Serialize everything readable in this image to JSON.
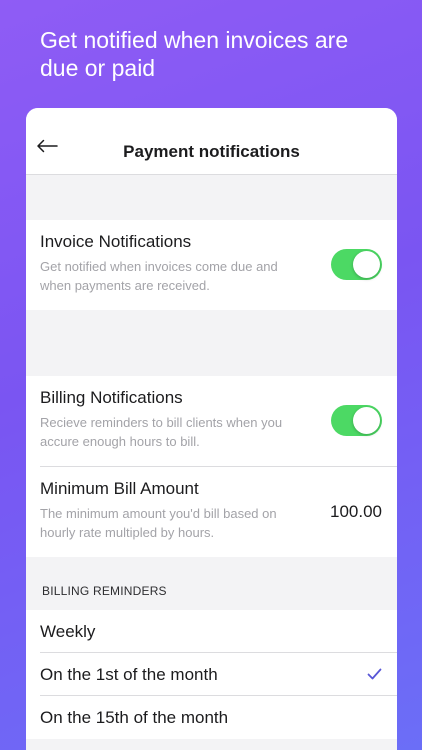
{
  "promo": {
    "headline": "Get notified when invoices are due or paid"
  },
  "navbar": {
    "title": "Payment notifications",
    "back_icon": "arrow-left-icon"
  },
  "invoice_notifications": {
    "title": "Invoice Notifications",
    "description": "Get notified when invoices come due and when payments are received.",
    "enabled": true
  },
  "billing_notifications": {
    "title": "Billing Notifications",
    "description": "Recieve reminders to bill clients when you accure enough hours to bill.",
    "enabled": true
  },
  "minimum_bill": {
    "title": "Minimum Bill Amount",
    "description": "The minimum amount you'd bill based on hourly rate multipled by hours.",
    "value": "100.00"
  },
  "billing_reminders": {
    "header": "BILLING REMINDERS",
    "options": [
      {
        "label": "Weekly",
        "selected": false
      },
      {
        "label": "On the 1st of the month",
        "selected": true
      },
      {
        "label": "On the 15th of the month",
        "selected": false
      }
    ],
    "check_icon": "checkmark-icon"
  },
  "colors": {
    "toggle_on": "#4cd964",
    "accent": "#5856d6",
    "background_gradient_start": "#8f5cf5",
    "background_gradient_end": "#6b6ef7"
  }
}
